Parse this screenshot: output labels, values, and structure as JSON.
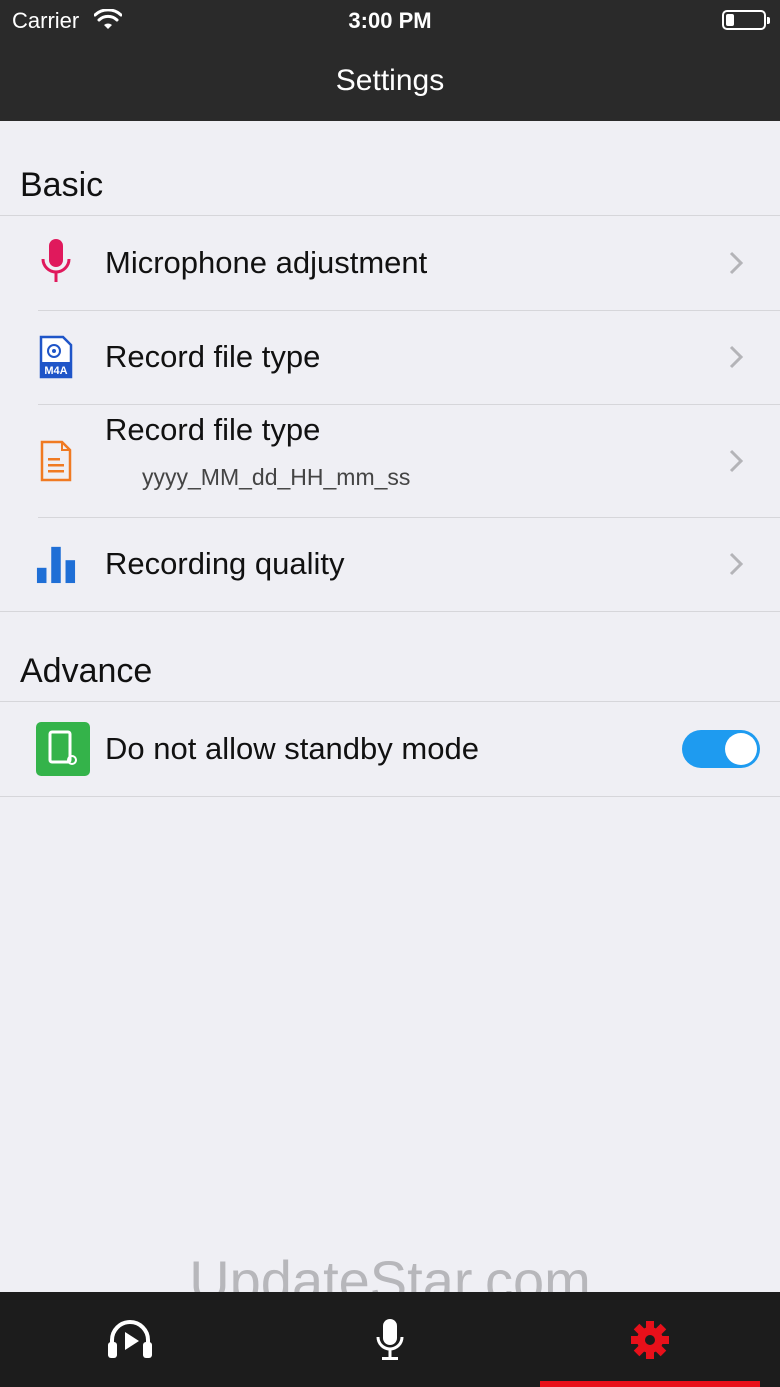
{
  "status_bar": {
    "carrier": "Carrier",
    "time": "3:00 PM"
  },
  "nav": {
    "title": "Settings"
  },
  "sections": {
    "basic": {
      "header": "Basic",
      "items": [
        {
          "label": "Microphone adjustment",
          "icon": "microphone-icon"
        },
        {
          "label": "Record file type",
          "icon": "m4a-file-icon",
          "icon_text": "M4A"
        },
        {
          "label": "Record file type",
          "sublabel": "yyyy_MM_dd_HH_mm_ss",
          "icon": "document-icon"
        },
        {
          "label": "Recording quality",
          "icon": "bar-chart-icon"
        }
      ]
    },
    "advance": {
      "header": "Advance",
      "items": [
        {
          "label": "Do not allow standby mode",
          "icon": "standby-icon",
          "toggle_on": true
        }
      ]
    }
  },
  "watermark": "UpdateStar.com",
  "tab_bar": {
    "tabs": [
      {
        "icon": "headphones-play-icon",
        "active": false
      },
      {
        "icon": "microphone-icon",
        "active": false
      },
      {
        "icon": "gear-icon",
        "active": true
      }
    ]
  },
  "colors": {
    "header_bg": "#2a2a2a",
    "page_bg": "#efeff4",
    "toggle_on": "#1e9bf0",
    "active_tab": "#e8101a",
    "mic_icon": "#e0195c",
    "doc_icon": "#f07a22",
    "chart_icon": "#1f6fd6",
    "standby_icon": "#34b34a"
  }
}
